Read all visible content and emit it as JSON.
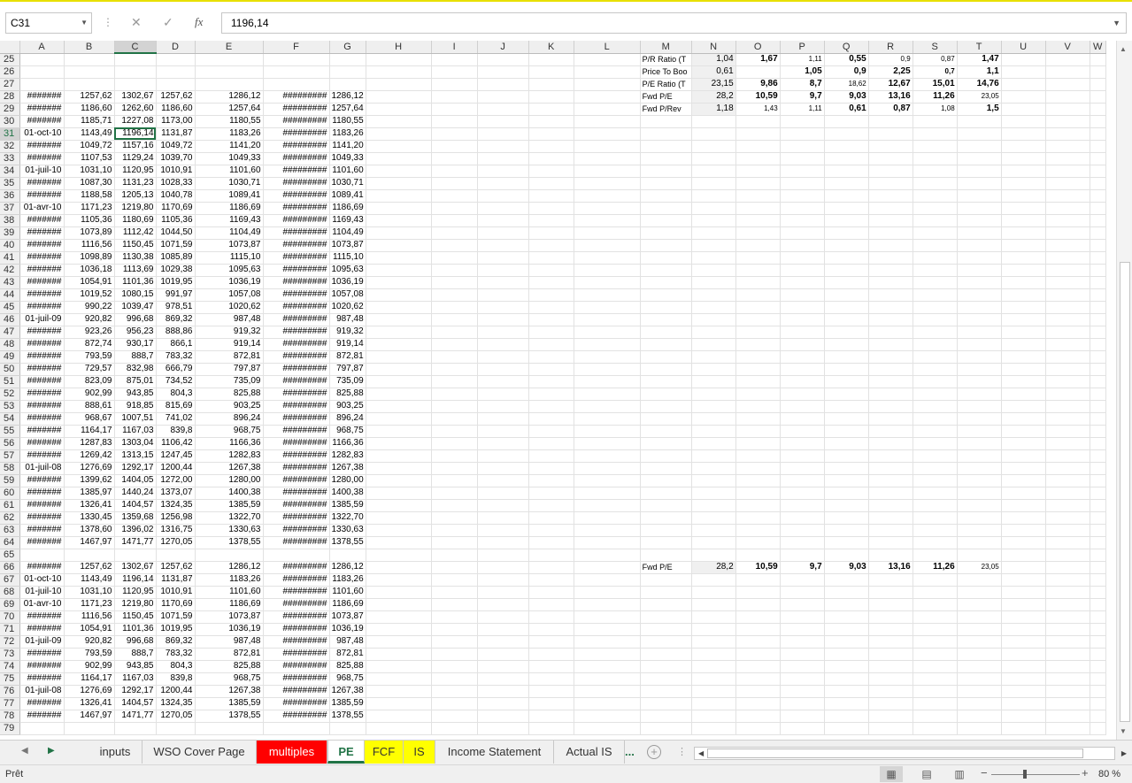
{
  "formula_bar": {
    "name_box": "C31",
    "cancel_icon": "✕",
    "enter_icon": "✓",
    "fx_label": "fx",
    "value": "1196,14"
  },
  "columns": [
    "A",
    "B",
    "C",
    "D",
    "E",
    "F",
    "G",
    "H",
    "I",
    "J",
    "K",
    "L",
    "M",
    "N",
    "O",
    "P",
    "Q",
    "R",
    "S",
    "T",
    "U",
    "V",
    "W"
  ],
  "rows": [
    {
      "n": "25",
      "c": [
        "",
        "",
        "",
        "",
        "",
        "",
        "",
        "P/R Ratio (T",
        "1,04",
        "1,67",
        "1,11",
        "0,55",
        "0,9",
        "0,87",
        "1,47"
      ]
    },
    {
      "n": "26",
      "c": [
        "",
        "",
        "",
        "",
        "",
        "",
        "",
        "Price To Boo",
        "0,61",
        "",
        "1,05",
        "0,9",
        "2,25",
        "0,7",
        "1,1"
      ]
    },
    {
      "n": "27",
      "c": [
        "",
        "",
        "",
        "",
        "",
        "",
        "",
        "P/E Ratio (T",
        "23,15",
        "9,86",
        "8,7",
        "18,62",
        "12,67",
        "15,01",
        "14,76"
      ]
    },
    {
      "n": "28",
      "c": [
        "#######",
        "1257,62",
        "1302,67",
        "1257,62",
        "1286,12",
        "#########",
        "1286,12",
        "Fwd P/E",
        "28,2",
        "10,59",
        "9,7",
        "9,03",
        "13,16",
        "11,26",
        "23,05"
      ]
    },
    {
      "n": "29",
      "c": [
        "#######",
        "1186,60",
        "1262,60",
        "1186,60",
        "1257,64",
        "#########",
        "1257,64",
        "Fwd P/Rev",
        "1,18",
        "1,43",
        "1,11",
        "0,61",
        "0,87",
        "1,08",
        "1,5"
      ]
    },
    {
      "n": "30",
      "c": [
        "#######",
        "1185,71",
        "1227,08",
        "1173,00",
        "1180,55",
        "#########",
        "1180,55",
        "",
        "",
        "",
        "",
        "",
        "",
        "",
        ""
      ]
    },
    {
      "n": "31",
      "c": [
        "01-oct-10",
        "1143,49",
        "1196,14",
        "1131,87",
        "1183,26",
        "#########",
        "1183,26",
        "",
        "",
        "",
        "",
        "",
        "",
        "",
        ""
      ]
    },
    {
      "n": "32",
      "c": [
        "#######",
        "1049,72",
        "1157,16",
        "1049,72",
        "1141,20",
        "#########",
        "1141,20",
        "",
        "",
        "",
        "",
        "",
        "",
        "",
        ""
      ]
    },
    {
      "n": "33",
      "c": [
        "#######",
        "1107,53",
        "1129,24",
        "1039,70",
        "1049,33",
        "#########",
        "1049,33",
        "",
        "",
        "",
        "",
        "",
        "",
        "",
        ""
      ]
    },
    {
      "n": "34",
      "c": [
        "01-juil-10",
        "1031,10",
        "1120,95",
        "1010,91",
        "1101,60",
        "#########",
        "1101,60",
        "",
        "",
        "",
        "",
        "",
        "",
        "",
        ""
      ]
    },
    {
      "n": "35",
      "c": [
        "#######",
        "1087,30",
        "1131,23",
        "1028,33",
        "1030,71",
        "#########",
        "1030,71",
        "",
        "",
        "",
        "",
        "",
        "",
        "",
        ""
      ]
    },
    {
      "n": "36",
      "c": [
        "#######",
        "1188,58",
        "1205,13",
        "1040,78",
        "1089,41",
        "#########",
        "1089,41",
        "",
        "",
        "",
        "",
        "",
        "",
        "",
        ""
      ]
    },
    {
      "n": "37",
      "c": [
        "01-avr-10",
        "1171,23",
        "1219,80",
        "1170,69",
        "1186,69",
        "#########",
        "1186,69",
        "",
        "",
        "",
        "",
        "",
        "",
        "",
        ""
      ]
    },
    {
      "n": "38",
      "c": [
        "#######",
        "1105,36",
        "1180,69",
        "1105,36",
        "1169,43",
        "#########",
        "1169,43",
        "",
        "",
        "",
        "",
        "",
        "",
        "",
        ""
      ]
    },
    {
      "n": "39",
      "c": [
        "#######",
        "1073,89",
        "1112,42",
        "1044,50",
        "1104,49",
        "#########",
        "1104,49",
        "",
        "",
        "",
        "",
        "",
        "",
        "",
        ""
      ]
    },
    {
      "n": "40",
      "c": [
        "#######",
        "1116,56",
        "1150,45",
        "1071,59",
        "1073,87",
        "#########",
        "1073,87",
        "",
        "",
        "",
        "",
        "",
        "",
        "",
        ""
      ]
    },
    {
      "n": "41",
      "c": [
        "#######",
        "1098,89",
        "1130,38",
        "1085,89",
        "1115,10",
        "#########",
        "1115,10",
        "",
        "",
        "",
        "",
        "",
        "",
        "",
        ""
      ]
    },
    {
      "n": "42",
      "c": [
        "#######",
        "1036,18",
        "1113,69",
        "1029,38",
        "1095,63",
        "#########",
        "1095,63",
        "",
        "",
        "",
        "",
        "",
        "",
        "",
        ""
      ]
    },
    {
      "n": "43",
      "c": [
        "#######",
        "1054,91",
        "1101,36",
        "1019,95",
        "1036,19",
        "#########",
        "1036,19",
        "",
        "",
        "",
        "",
        "",
        "",
        "",
        ""
      ]
    },
    {
      "n": "44",
      "c": [
        "#######",
        "1019,52",
        "1080,15",
        "991,97",
        "1057,08",
        "#########",
        "1057,08",
        "",
        "",
        "",
        "",
        "",
        "",
        "",
        ""
      ]
    },
    {
      "n": "45",
      "c": [
        "#######",
        "990,22",
        "1039,47",
        "978,51",
        "1020,62",
        "#########",
        "1020,62",
        "",
        "",
        "",
        "",
        "",
        "",
        "",
        ""
      ]
    },
    {
      "n": "46",
      "c": [
        "01-juil-09",
        "920,82",
        "996,68",
        "869,32",
        "987,48",
        "#########",
        "987,48",
        "",
        "",
        "",
        "",
        "",
        "",
        "",
        ""
      ]
    },
    {
      "n": "47",
      "c": [
        "#######",
        "923,26",
        "956,23",
        "888,86",
        "919,32",
        "#########",
        "919,32",
        "",
        "",
        "",
        "",
        "",
        "",
        "",
        ""
      ]
    },
    {
      "n": "48",
      "c": [
        "#######",
        "872,74",
        "930,17",
        "866,1",
        "919,14",
        "#########",
        "919,14",
        "",
        "",
        "",
        "",
        "",
        "",
        "",
        ""
      ]
    },
    {
      "n": "49",
      "c": [
        "#######",
        "793,59",
        "888,7",
        "783,32",
        "872,81",
        "#########",
        "872,81",
        "",
        "",
        "",
        "",
        "",
        "",
        "",
        ""
      ]
    },
    {
      "n": "50",
      "c": [
        "#######",
        "729,57",
        "832,98",
        "666,79",
        "797,87",
        "#########",
        "797,87",
        "",
        "",
        "",
        "",
        "",
        "",
        "",
        ""
      ]
    },
    {
      "n": "51",
      "c": [
        "#######",
        "823,09",
        "875,01",
        "734,52",
        "735,09",
        "#########",
        "735,09",
        "",
        "",
        "",
        "",
        "",
        "",
        "",
        ""
      ]
    },
    {
      "n": "52",
      "c": [
        "#######",
        "902,99",
        "943,85",
        "804,3",
        "825,88",
        "#########",
        "825,88",
        "",
        "",
        "",
        "",
        "",
        "",
        "",
        ""
      ]
    },
    {
      "n": "53",
      "c": [
        "#######",
        "888,61",
        "918,85",
        "815,69",
        "903,25",
        "#########",
        "903,25",
        "",
        "",
        "",
        "",
        "",
        "",
        "",
        ""
      ]
    },
    {
      "n": "54",
      "c": [
        "#######",
        "968,67",
        "1007,51",
        "741,02",
        "896,24",
        "#########",
        "896,24",
        "",
        "",
        "",
        "",
        "",
        "",
        "",
        ""
      ]
    },
    {
      "n": "55",
      "c": [
        "#######",
        "1164,17",
        "1167,03",
        "839,8",
        "968,75",
        "#########",
        "968,75",
        "",
        "",
        "",
        "",
        "",
        "",
        "",
        ""
      ]
    },
    {
      "n": "56",
      "c": [
        "#######",
        "1287,83",
        "1303,04",
        "1106,42",
        "1166,36",
        "#########",
        "1166,36",
        "",
        "",
        "",
        "",
        "",
        "",
        "",
        ""
      ]
    },
    {
      "n": "57",
      "c": [
        "#######",
        "1269,42",
        "1313,15",
        "1247,45",
        "1282,83",
        "#########",
        "1282,83",
        "",
        "",
        "",
        "",
        "",
        "",
        "",
        ""
      ]
    },
    {
      "n": "58",
      "c": [
        "01-juil-08",
        "1276,69",
        "1292,17",
        "1200,44",
        "1267,38",
        "#########",
        "1267,38",
        "",
        "",
        "",
        "",
        "",
        "",
        "",
        ""
      ]
    },
    {
      "n": "59",
      "c": [
        "#######",
        "1399,62",
        "1404,05",
        "1272,00",
        "1280,00",
        "#########",
        "1280,00",
        "",
        "",
        "",
        "",
        "",
        "",
        "",
        ""
      ]
    },
    {
      "n": "60",
      "c": [
        "#######",
        "1385,97",
        "1440,24",
        "1373,07",
        "1400,38",
        "#########",
        "1400,38",
        "",
        "",
        "",
        "",
        "",
        "",
        "",
        ""
      ]
    },
    {
      "n": "61",
      "c": [
        "#######",
        "1326,41",
        "1404,57",
        "1324,35",
        "1385,59",
        "#########",
        "1385,59",
        "",
        "",
        "",
        "",
        "",
        "",
        "",
        ""
      ]
    },
    {
      "n": "62",
      "c": [
        "#######",
        "1330,45",
        "1359,68",
        "1256,98",
        "1322,70",
        "#########",
        "1322,70",
        "",
        "",
        "",
        "",
        "",
        "",
        "",
        ""
      ]
    },
    {
      "n": "63",
      "c": [
        "#######",
        "1378,60",
        "1396,02",
        "1316,75",
        "1330,63",
        "#########",
        "1330,63",
        "",
        "",
        "",
        "",
        "",
        "",
        "",
        ""
      ]
    },
    {
      "n": "64",
      "c": [
        "#######",
        "1467,97",
        "1471,77",
        "1270,05",
        "1378,55",
        "#########",
        "1378,55",
        "",
        "",
        "",
        "",
        "",
        "",
        "",
        ""
      ]
    },
    {
      "n": "65",
      "c": [
        "",
        "",
        "",
        "",
        "",
        "",
        "",
        "",
        "",
        "",
        "",
        "",
        "",
        "",
        ""
      ]
    },
    {
      "n": "66",
      "c": [
        "#######",
        "1257,62",
        "1302,67",
        "1257,62",
        "1286,12",
        "#########",
        "1286,12",
        "Fwd P/E",
        "28,2",
        "10,59",
        "9,7",
        "9,03",
        "13,16",
        "11,26",
        "23,05"
      ]
    },
    {
      "n": "67",
      "c": [
        "01-oct-10",
        "1143,49",
        "1196,14",
        "1131,87",
        "1183,26",
        "#########",
        "1183,26",
        "",
        "",
        "",
        "",
        "",
        "",
        "",
        ""
      ]
    },
    {
      "n": "68",
      "c": [
        "01-juil-10",
        "1031,10",
        "1120,95",
        "1010,91",
        "1101,60",
        "#########",
        "1101,60",
        "",
        "",
        "",
        "",
        "",
        "",
        "",
        ""
      ]
    },
    {
      "n": "69",
      "c": [
        "01-avr-10",
        "1171,23",
        "1219,80",
        "1170,69",
        "1186,69",
        "#########",
        "1186,69",
        "",
        "",
        "",
        "",
        "",
        "",
        "",
        ""
      ]
    },
    {
      "n": "70",
      "c": [
        "#######",
        "1116,56",
        "1150,45",
        "1071,59",
        "1073,87",
        "#########",
        "1073,87",
        "",
        "",
        "",
        "",
        "",
        "",
        "",
        ""
      ]
    },
    {
      "n": "71",
      "c": [
        "#######",
        "1054,91",
        "1101,36",
        "1019,95",
        "1036,19",
        "#########",
        "1036,19",
        "",
        "",
        "",
        "",
        "",
        "",
        "",
        ""
      ]
    },
    {
      "n": "72",
      "c": [
        "01-juil-09",
        "920,82",
        "996,68",
        "869,32",
        "987,48",
        "#########",
        "987,48",
        "",
        "",
        "",
        "",
        "",
        "",
        "",
        ""
      ]
    },
    {
      "n": "73",
      "c": [
        "#######",
        "793,59",
        "888,7",
        "783,32",
        "872,81",
        "#########",
        "872,81",
        "",
        "",
        "",
        "",
        "",
        "",
        "",
        ""
      ]
    },
    {
      "n": "74",
      "c": [
        "#######",
        "902,99",
        "943,85",
        "804,3",
        "825,88",
        "#########",
        "825,88",
        "",
        "",
        "",
        "",
        "",
        "",
        "",
        ""
      ]
    },
    {
      "n": "75",
      "c": [
        "#######",
        "1164,17",
        "1167,03",
        "839,8",
        "968,75",
        "#########",
        "968,75",
        "",
        "",
        "",
        "",
        "",
        "",
        "",
        ""
      ]
    },
    {
      "n": "76",
      "c": [
        "01-juil-08",
        "1276,69",
        "1292,17",
        "1200,44",
        "1267,38",
        "#########",
        "1267,38",
        "",
        "",
        "",
        "",
        "",
        "",
        "",
        ""
      ]
    },
    {
      "n": "77",
      "c": [
        "#######",
        "1326,41",
        "1404,57",
        "1324,35",
        "1385,59",
        "#########",
        "1385,59",
        "",
        "",
        "",
        "",
        "",
        "",
        "",
        ""
      ]
    },
    {
      "n": "78",
      "c": [
        "#######",
        "1467,97",
        "1471,77",
        "1270,05",
        "1378,55",
        "#########",
        "1378,55",
        "",
        "",
        "",
        "",
        "",
        "",
        "",
        ""
      ]
    },
    {
      "n": "79",
      "c": [
        "",
        "",
        "",
        "",
        "",
        "",
        "",
        "",
        "",
        "",
        "",
        "",
        "",
        "",
        ""
      ]
    }
  ],
  "tabs": [
    {
      "label": "inputs",
      "style": "normal"
    },
    {
      "label": "WSO Cover Page",
      "style": "normal"
    },
    {
      "label": "multiples",
      "style": "red"
    },
    {
      "label": "PE",
      "style": "active"
    },
    {
      "label": "FCF",
      "style": "yellow"
    },
    {
      "label": "IS",
      "style": "yellow"
    },
    {
      "label": "Income Statement",
      "style": "normal"
    },
    {
      "label": "Actual IS",
      "style": "normal"
    }
  ],
  "tab_more": "...",
  "status": {
    "text": "Prêt",
    "zoom": "80 %"
  },
  "colors": {
    "accent": "#217346",
    "tab_red": "#ff0000",
    "tab_yellow": "#ffff00"
  }
}
